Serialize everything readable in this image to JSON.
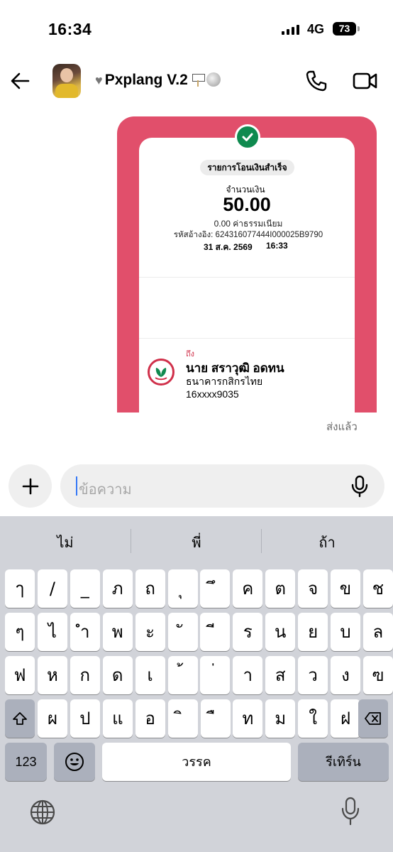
{
  "status_bar": {
    "time": "16:34",
    "network": "4G",
    "battery": "73"
  },
  "header": {
    "contact_name": "Pxplang V.2",
    "icons": [
      "back-arrow-icon",
      "heart-icon",
      "sign-icon",
      "disco-ball-icon",
      "phone-icon",
      "video-camera-icon"
    ]
  },
  "message": {
    "slip": {
      "status": "รายการโอนเงินสำเร็จ",
      "amount_label": "จำนวนเงิน",
      "amount": "50.00",
      "fee": "0.00 ค่าธรรมเนียม",
      "reference": "รหัสอ้างอิง: 624316077444I000025B9790",
      "date": "31 ส.ค. 2569",
      "time": "16:33",
      "to_label": "ถึง",
      "recipient_name": "นาย สราวุฒิ อดทน",
      "recipient_bank": "ธนาคารกสิกรไทย",
      "recipient_account": "16xxxx9035"
    },
    "status": "ส่งแล้ว",
    "accent_color": "#e14f6b",
    "success_color": "#0f8a4f"
  },
  "composer": {
    "placeholder": "ข้อความ"
  },
  "keyboard": {
    "suggestions": [
      "ไม่",
      "พี่",
      "ถ้า"
    ],
    "row1": [
      "ๅ",
      "/",
      "_",
      "ภ",
      "ถ",
      "ุ",
      "ึ",
      "ค",
      "ต",
      "จ",
      "ข",
      "ช"
    ],
    "row2": [
      "ๆ",
      "ไ",
      "ำ",
      "พ",
      "ะ",
      "ั",
      "ี",
      "ร",
      "น",
      "ย",
      "บ",
      "ล"
    ],
    "row3": [
      "ฟ",
      "ห",
      "ก",
      "ด",
      "เ",
      "้",
      "่",
      "า",
      "ส",
      "ว",
      "ง",
      "ฃ"
    ],
    "row4": [
      "ผ",
      "ป",
      "แ",
      "อ",
      "ิ",
      "ื",
      "ท",
      "ม",
      "ใ",
      "ฝ"
    ],
    "numbers_key": "123",
    "space_key": "วรรค",
    "return_key": "รีเทิร์น"
  }
}
